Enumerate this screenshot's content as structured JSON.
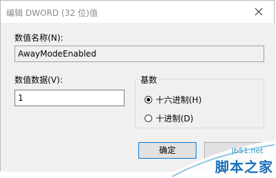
{
  "title": "编辑 DWORD (32 位)值",
  "value_name": {
    "label": "数值名称(N):",
    "value": "AwayModeEnabled"
  },
  "value_data": {
    "label": "数值数据(V):",
    "value": "1"
  },
  "base": {
    "label": "基数",
    "options": [
      {
        "label": "十六进制(H)",
        "selected": true
      },
      {
        "label": "十进制(D)",
        "selected": false
      }
    ]
  },
  "buttons": {
    "ok": "确定",
    "cancel": ""
  },
  "watermark": {
    "site": "jb51.net",
    "text": "脚本之家"
  }
}
